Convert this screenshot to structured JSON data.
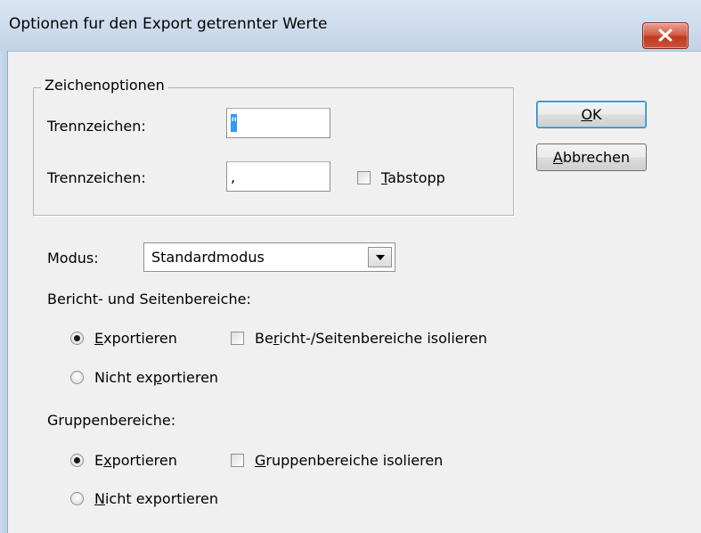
{
  "window": {
    "title": "Optionen fur den Export getrennter Werte"
  },
  "buttons": {
    "ok": {
      "pre": "",
      "acc": "O",
      "post": "K"
    },
    "cancel": {
      "pre": "",
      "acc": "A",
      "post": "bbrechen"
    }
  },
  "zeichenoptionen": {
    "group_label": "Zeichenoptionen",
    "separator1_label": "Trennzeichen:",
    "separator1_value": "\"",
    "separator2_label": "Trennzeichen:",
    "separator2_value": ",",
    "tabstop": {
      "checked": false,
      "pre": "",
      "acc": "T",
      "post": "abstopp"
    }
  },
  "mode": {
    "label": "Modus:",
    "value": "Standardmodus"
  },
  "report_areas": {
    "heading": "Bericht- und Seitenbereiche:",
    "export": {
      "selected": true,
      "pre": "",
      "acc": "E",
      "post": "xportieren"
    },
    "isolate": {
      "checked": false,
      "pre": "Be",
      "acc": "r",
      "post": "icht-/Seitenbereiche isolieren"
    },
    "no_export": {
      "selected": false,
      "pre": "Nicht ex",
      "acc": "p",
      "post": "ortieren"
    }
  },
  "group_areas": {
    "heading": "Gruppenbereiche:",
    "export": {
      "selected": true,
      "pre": "E",
      "acc": "x",
      "post": "portieren"
    },
    "isolate": {
      "checked": false,
      "pre": "",
      "acc": "G",
      "post": "ruppenbereiche isolieren"
    },
    "no_export": {
      "selected": false,
      "pre": "",
      "acc": "N",
      "post": "icht exportieren"
    }
  }
}
